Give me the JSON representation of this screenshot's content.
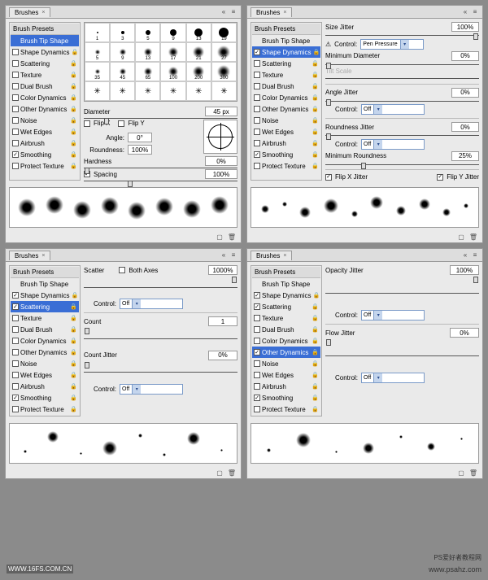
{
  "watermarks": {
    "bl": "WWW.16FS.COM.CN",
    "tr": "PS爱好者教程网",
    "br": "www.psahz.com"
  },
  "tabTitle": "Brushes",
  "sidebarHeader": "Brush Presets",
  "sidebarItems": [
    {
      "label": "Brush Tip Shape",
      "cb": null
    },
    {
      "label": "Shape Dynamics",
      "cb": true,
      "lock": true
    },
    {
      "label": "Scattering",
      "cb": true,
      "lock": true
    },
    {
      "label": "Texture",
      "cb": false,
      "lock": true
    },
    {
      "label": "Dual Brush",
      "cb": false,
      "lock": true
    },
    {
      "label": "Color Dynamics",
      "cb": false,
      "lock": true
    },
    {
      "label": "Other Dynamics",
      "cb": true,
      "lock": true
    },
    {
      "label": "Noise",
      "cb": false,
      "lock": true
    },
    {
      "label": "Wet Edges",
      "cb": false,
      "lock": true
    },
    {
      "label": "Airbrush",
      "cb": false,
      "lock": true
    },
    {
      "label": "Smoothing",
      "cb": true,
      "lock": true
    },
    {
      "label": "Protect Texture",
      "cb": false,
      "lock": true
    }
  ],
  "panel1": {
    "selected": 0,
    "brushSizes": [
      "1",
      "3",
      "5",
      "9",
      "13",
      "19",
      "5",
      "9",
      "13",
      "17",
      "21",
      "27",
      "35",
      "45",
      "65",
      "100",
      "200",
      "300",
      "*",
      "*",
      "*",
      "*",
      "*",
      "*"
    ],
    "diameterLabel": "Diameter",
    "diameter": "45 px",
    "flipX": "Flip X",
    "flipY": "Flip Y",
    "angleLabel": "Angle:",
    "angle": "0°",
    "roundLabel": "Roundness:",
    "roundness": "100%",
    "hardLabel": "Hardness",
    "hardness": "0%",
    "spacingLabel": "Spacing",
    "spacing": "100%"
  },
  "panel2": {
    "selected": 1,
    "sizeJitterLabel": "Size Jitter",
    "sizeJitter": "100%",
    "controlLabel": "Control:",
    "controlVal": "Pen Pressure",
    "minDiamLabel": "Minimum Diameter",
    "minDiam": "0%",
    "tiltLabel": "Tilt Scale",
    "angleJitterLabel": "Angle Jitter",
    "angleJitter": "0%",
    "control2": "Off",
    "roundJitterLabel": "Roundness Jitter",
    "roundJitter": "0%",
    "control3": "Off",
    "minRoundLabel": "Minimum Roundness",
    "minRound": "25%",
    "flipXJ": "Flip X Jitter",
    "flipYJ": "Flip Y Jitter",
    "sidebarCb": {
      "shape": true,
      "scatter": false,
      "other": false
    }
  },
  "panel3": {
    "selected": 2,
    "scatterLabel": "Scatter",
    "bothAxes": "Both Axes",
    "scatter": "1000%",
    "controlLabel": "Control:",
    "control": "Off",
    "countLabel": "Count",
    "count": "1",
    "countJitterLabel": "Count Jitter",
    "countJitter": "0%",
    "control2": "Off",
    "sidebarCb": {
      "shape": true,
      "other": false
    }
  },
  "panel4": {
    "selected": 6,
    "opJitterLabel": "Opacity Jitter",
    "opJitter": "100%",
    "controlLabel": "Control:",
    "control": "Off",
    "flowJitterLabel": "Flow Jitter",
    "flowJitter": "0%",
    "control2": "Off",
    "sidebarCb": {
      "shape": true,
      "scatter": true
    }
  }
}
